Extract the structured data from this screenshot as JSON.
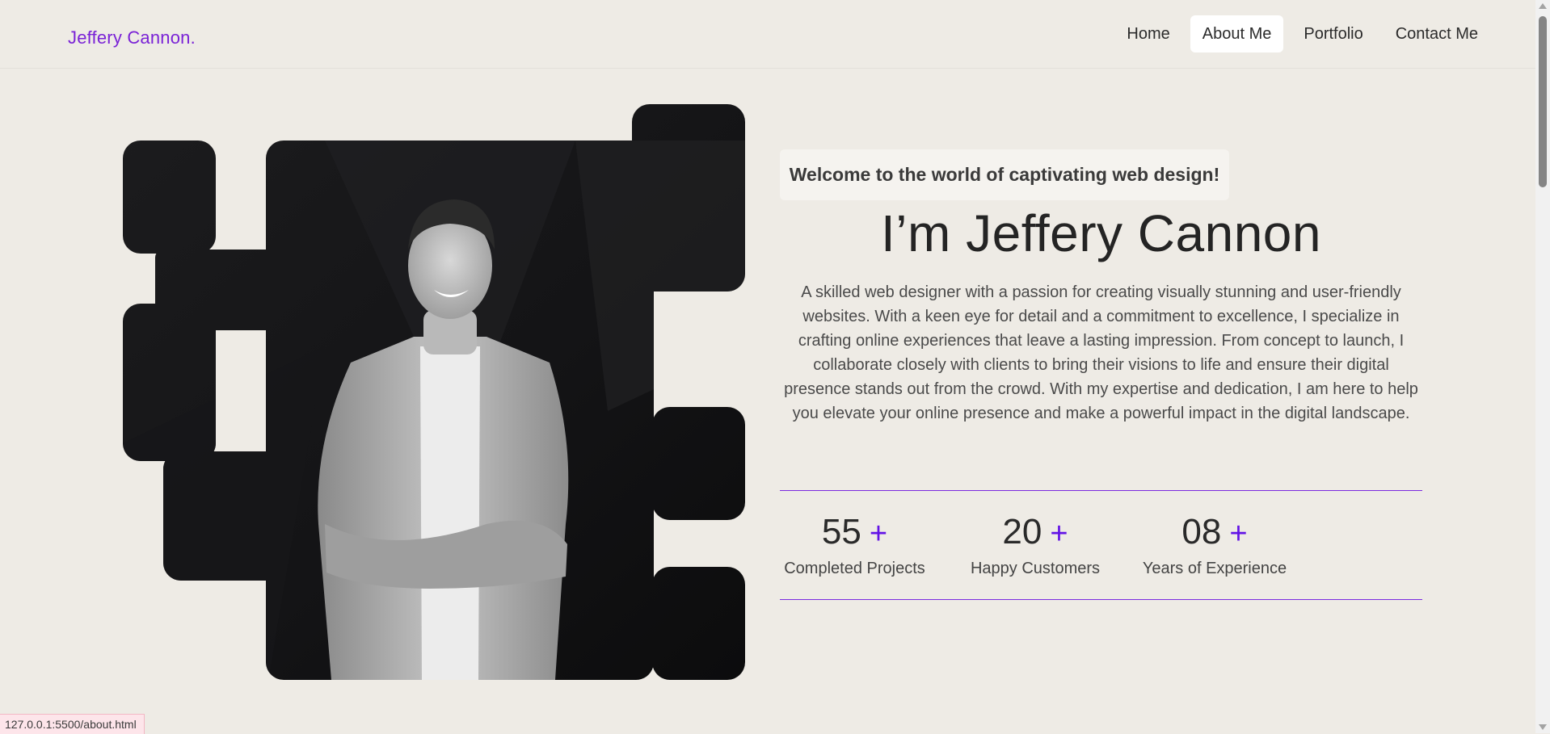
{
  "header": {
    "logo": "Jeffery Cannon.",
    "nav": [
      {
        "label": "Home",
        "active": false
      },
      {
        "label": "About Me",
        "active": true
      },
      {
        "label": "Portfolio",
        "active": false
      },
      {
        "label": "Contact Me",
        "active": false
      }
    ]
  },
  "hero": {
    "welcome": "Welcome to the world of captivating web design!",
    "heading": "I’m Jeffery Cannon",
    "description": "A skilled web designer with a passion for creating visually stunning and user-friendly websites. With a keen eye for detail and a commitment to excellence, I specialize in crafting online experiences that leave a lasting impression. From concept to launch, I collaborate closely with clients to bring their visions to life and ensure their digital presence stands out from the crowd. With my expertise and dedication, I am here to help you elevate your online presence and make a powerful impact in the digital landscape."
  },
  "stats": [
    {
      "value": "55",
      "suffix": "+",
      "label": "Completed Projects"
    },
    {
      "value": "20",
      "suffix": "+",
      "label": "Happy Customers"
    },
    {
      "value": "08",
      "suffix": "+",
      "label": "Years of Experience"
    }
  ],
  "status_url": "127.0.0.1:5500/about.html",
  "colors": {
    "accent": "#7a22d6",
    "plus": "#6313e6",
    "background": "#eeebe5"
  }
}
